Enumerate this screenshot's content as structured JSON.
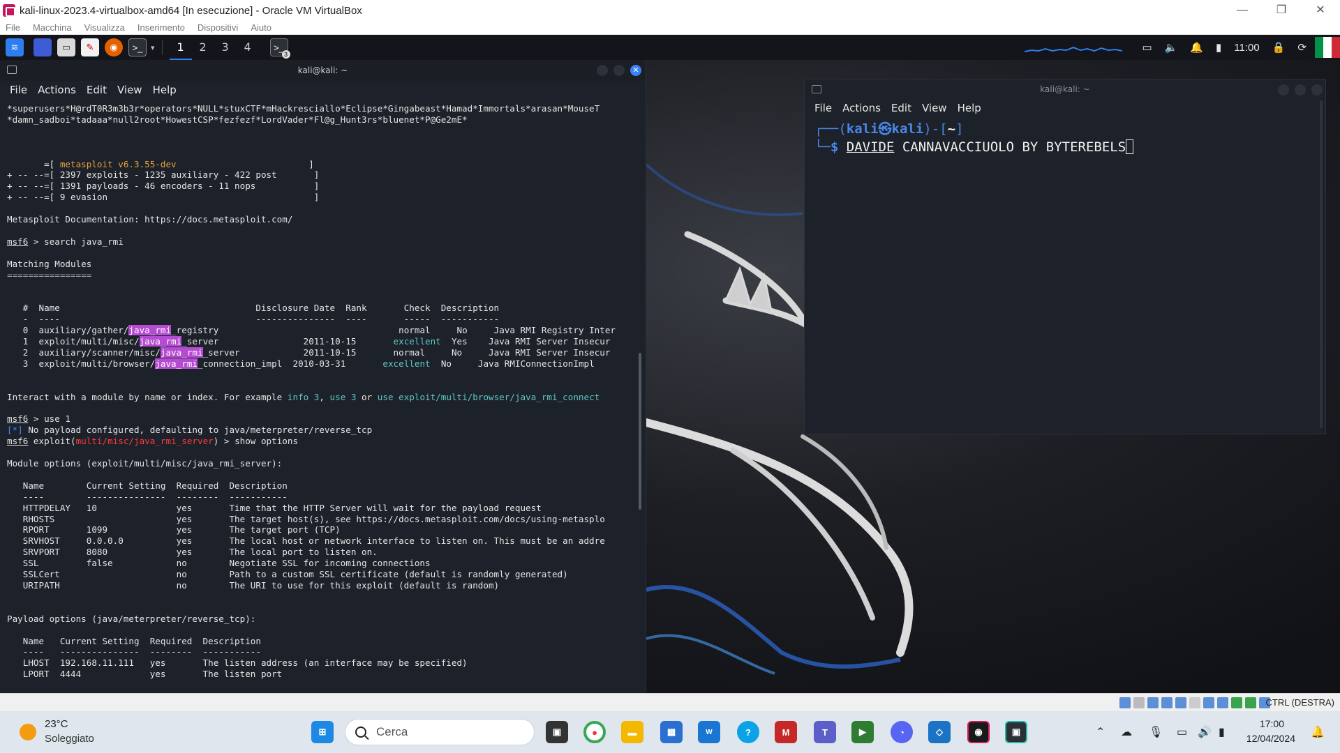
{
  "vbox": {
    "title": "kali-linux-2023.4-virtualbox-amd64 [In esecuzione] - Oracle VM VirtualBox",
    "menu": [
      "File",
      "Macchina",
      "Visualizza",
      "Inserimento",
      "Dispositivi",
      "Aiuto"
    ],
    "status_host_key": "CTRL (DESTRA)"
  },
  "kali_panel": {
    "workspaces": [
      "1",
      "2",
      "3",
      "4"
    ],
    "terminal_badge": "3",
    "clock": "11:00"
  },
  "term1": {
    "title": "kali@kali: ~",
    "menu": [
      "File",
      "Actions",
      "Edit",
      "View",
      "Help"
    ],
    "banner_line1": "*superusers*H@rdT0R3m3b3r*operators*NULL*stuxCTF*mHackresciallo*Eclipse*Gingabeast*Hamad*Immortals*arasan*MouseT",
    "banner_line2": "*damn_sadboi*tadaaa*null2root*HowestCSP*fezfezf*LordVader*Fl@g_Hunt3rs*bluenet*P@Ge2mE*",
    "msf_version_pre": "       =[ ",
    "msf_version": "metasploit v6.3.55-dev",
    "msf_version_post": "                         ]",
    "msf_stats": [
      "+ -- --=[ 2397 exploits - 1235 auxiliary - 422 post       ]",
      "+ -- --=[ 1391 payloads - 46 encoders - 11 nops           ]",
      "+ -- --=[ 9 evasion                                       ]"
    ],
    "docs": "Metasploit Documentation: https://docs.metasploit.com/",
    "prompt": "msf6",
    "cmd_search": " > search java_rmi",
    "matching_title": "Matching Modules",
    "matching_underline": "================",
    "mod_header": "   #  Name                                     Disclosure Date  Rank       Check  Description",
    "mod_header_ul": "   -  ----                                     ---------------  ----       -----  -----------",
    "modules": [
      {
        "num": "   0  ",
        "pre": "auxiliary/gather/",
        "hl": "java_rmi",
        "post": "_registry",
        "pad": "                                  ",
        "date": "",
        "rank": "normal",
        "rank_pad": "     ",
        "check": "No     ",
        "desc": "Java RMI Registry Inter"
      },
      {
        "num": "   1  ",
        "pre": "exploit/multi/misc/",
        "hl": "java_rmi",
        "post": "_server",
        "pad": "                ",
        "date": "2011-10-15       ",
        "rank": "excellent",
        "rank_pad": "  ",
        "check": "Yes    ",
        "desc": "Java RMI Server Insecur"
      },
      {
        "num": "   2  ",
        "pre": "auxiliary/scanner/misc/",
        "hl": "java_rmi",
        "post": "_server",
        "pad": "            ",
        "date": "2011-10-15       ",
        "rank": "normal",
        "rank_pad": "     ",
        "check": "No     ",
        "desc": "Java RMI Server Insecur"
      },
      {
        "num": "   3  ",
        "pre": "exploit/multi/browser/",
        "hl": "java_rmi",
        "post": "_connection_impl",
        "pad": "  ",
        "date": "2010-03-31       ",
        "rank": "excellent",
        "rank_pad": "  ",
        "check": "No     ",
        "desc": "Java RMIConnectionImpl"
      }
    ],
    "interact_pre": "Interact with a module by name or index. For example ",
    "interact_info": "info 3",
    "interact_sep": ", ",
    "interact_use": "use 3",
    "interact_or": " or ",
    "interact_use2": "use exploit/multi/browser/java_rmi_connect",
    "cmd_use": " > use 1",
    "info_marker": "[*]",
    "info_text": " No payload configured, defaulting to java/meterpreter/reverse_tcp",
    "exploit_pre": " exploit(",
    "exploit_mod": "multi/misc/java_rmi_server",
    "exploit_post": ") > show options",
    "module_options_title": "Module options (exploit/multi/misc/java_rmi_server):",
    "opt_header": "   Name        Current Setting  Required  Description",
    "opt_header_ul": "   ----        ---------------  --------  -----------",
    "options": [
      "   HTTPDELAY   10               yes       Time that the HTTP Server will wait for the payload request",
      "   RHOSTS                       yes       The target host(s), see https://docs.metasploit.com/docs/using-metasplo",
      "   RPORT       1099             yes       The target port (TCP)",
      "   SRVHOST     0.0.0.0          yes       The local host or network interface to listen on. This must be an addre",
      "   SRVPORT     8080             yes       The local port to listen on.",
      "   SSL         false            no        Negotiate SSL for incoming connections",
      "   SSLCert                      no        Path to a custom SSL certificate (default is randomly generated)",
      "   URIPATH                      no        The URI to use for this exploit (default is random)"
    ],
    "payload_options_title": "Payload options (java/meterpreter/reverse_tcp):",
    "pay_header": "   Name   Current Setting  Required  Description",
    "pay_header_ul": "   ----   ---------------  --------  -----------",
    "payload_options": [
      "   LHOST  192.168.11.111   yes       The listen address (an interface may be specified)",
      "   LPORT  4444             yes       The listen port"
    ]
  },
  "term2": {
    "title": "kali@kali: ~",
    "menu": [
      "File",
      "Actions",
      "Edit",
      "View",
      "Help"
    ],
    "prompt_top_a": "┌──(",
    "prompt_user": "kali㉿kali",
    "prompt_top_b": ")-[",
    "prompt_dir": "~",
    "prompt_top_c": "]",
    "prompt_bottom": "└─",
    "prompt_dollar": "$ ",
    "typed_first": "DAVIDE",
    "typed_rest": " CANNAVACCIUOLO BY BYTEREBELS"
  },
  "windows": {
    "temp": "23°C",
    "weather": "Soleggiato",
    "search_placeholder": "Cerca",
    "time": "17:00",
    "date": "12/04/2024"
  },
  "colors": {
    "kali_blue": "#2f7ef0",
    "msf_orange": "#e6a23c",
    "link_cyan": "#5cc8c8",
    "error_red": "#ff3b3b",
    "highlight_purple": "#b44bd1"
  }
}
